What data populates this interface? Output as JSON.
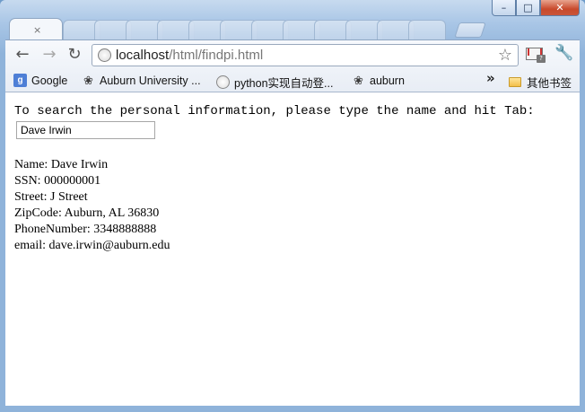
{
  "browser": {
    "url_host": "localhost",
    "url_path": "/html/findpi.html",
    "window_controls": {
      "minimize": "–",
      "maximize": "□",
      "close": "✕"
    },
    "tab_close": "×"
  },
  "bookmarks": [
    {
      "label": "Google",
      "icon": "google-icon"
    },
    {
      "label": "Auburn University ...",
      "icon": "auburn-icon"
    },
    {
      "label": "python实现自动登...",
      "icon": "globe-icon"
    },
    {
      "label": "auburn",
      "icon": "auburn-icon"
    }
  ],
  "bookmarks_overflow": "»",
  "other_bookmarks": "其他书签",
  "page": {
    "prompt": "To search the personal information, please type the name and hit Tab:",
    "input_value": "Dave Irwin",
    "results": {
      "name": "Name: Dave Irwin",
      "ssn": "SSN: 000000001",
      "street": "Street: J Street",
      "zipcode": "ZipCode: Auburn, AL 36830",
      "phone": "PhoneNumber: 3348888888",
      "email": "email: dave.irwin@auburn.edu"
    }
  }
}
